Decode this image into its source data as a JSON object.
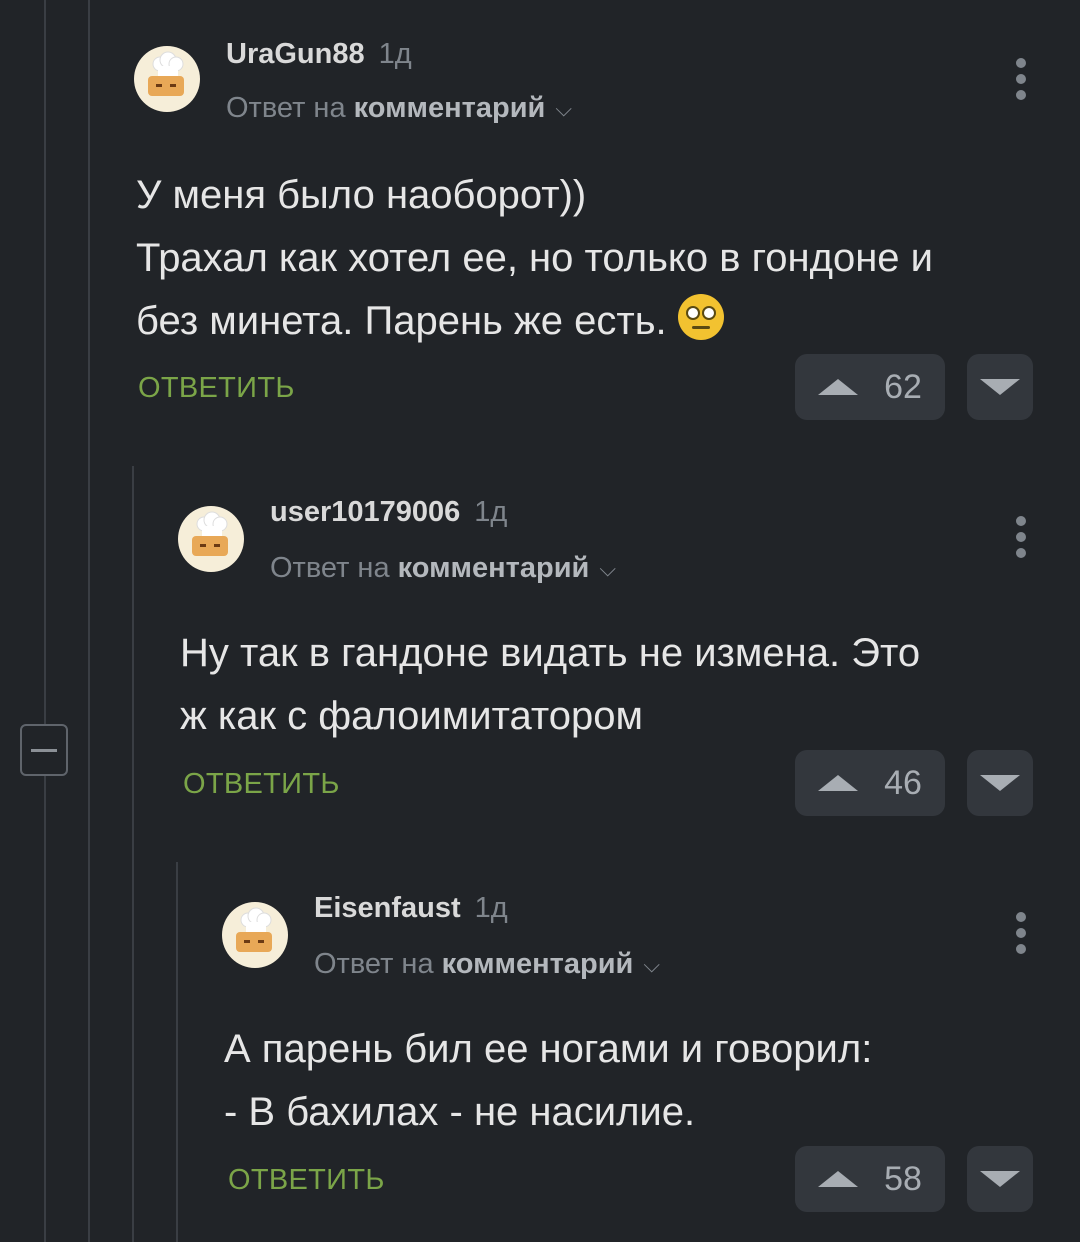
{
  "comments": [
    {
      "username": "UraGun88",
      "time": "1д",
      "reply_prefix": "Ответ на",
      "reply_target": "комментарий",
      "body": "У меня было наоборот))\nТрахал как хотел ее, но только в гондоне и\nбез минета. Парень же есть.",
      "emoji": "eye-roll-emoji",
      "reply_label": "ОТВЕТИТЬ",
      "rating": "62"
    },
    {
      "username": "user10179006",
      "time": "1д",
      "reply_prefix": "Ответ на",
      "reply_target": "комментарий",
      "body": "Ну так в гандоне видать не измена. Это\nж как с фалоимитатором",
      "reply_label": "ОТВЕТИТЬ",
      "rating": "46"
    },
    {
      "username": "Eisenfaust",
      "time": "1д",
      "reply_prefix": "Ответ на",
      "reply_target": "комментарий",
      "body": "А парень бил ее ногами и говорил:\n- В бахилах - не насилие.",
      "reply_label": "ОТВЕТИТЬ",
      "rating": "58"
    }
  ],
  "colors": {
    "background": "#212428",
    "reply_green": "#7ba548",
    "muted": "#7f858c"
  }
}
